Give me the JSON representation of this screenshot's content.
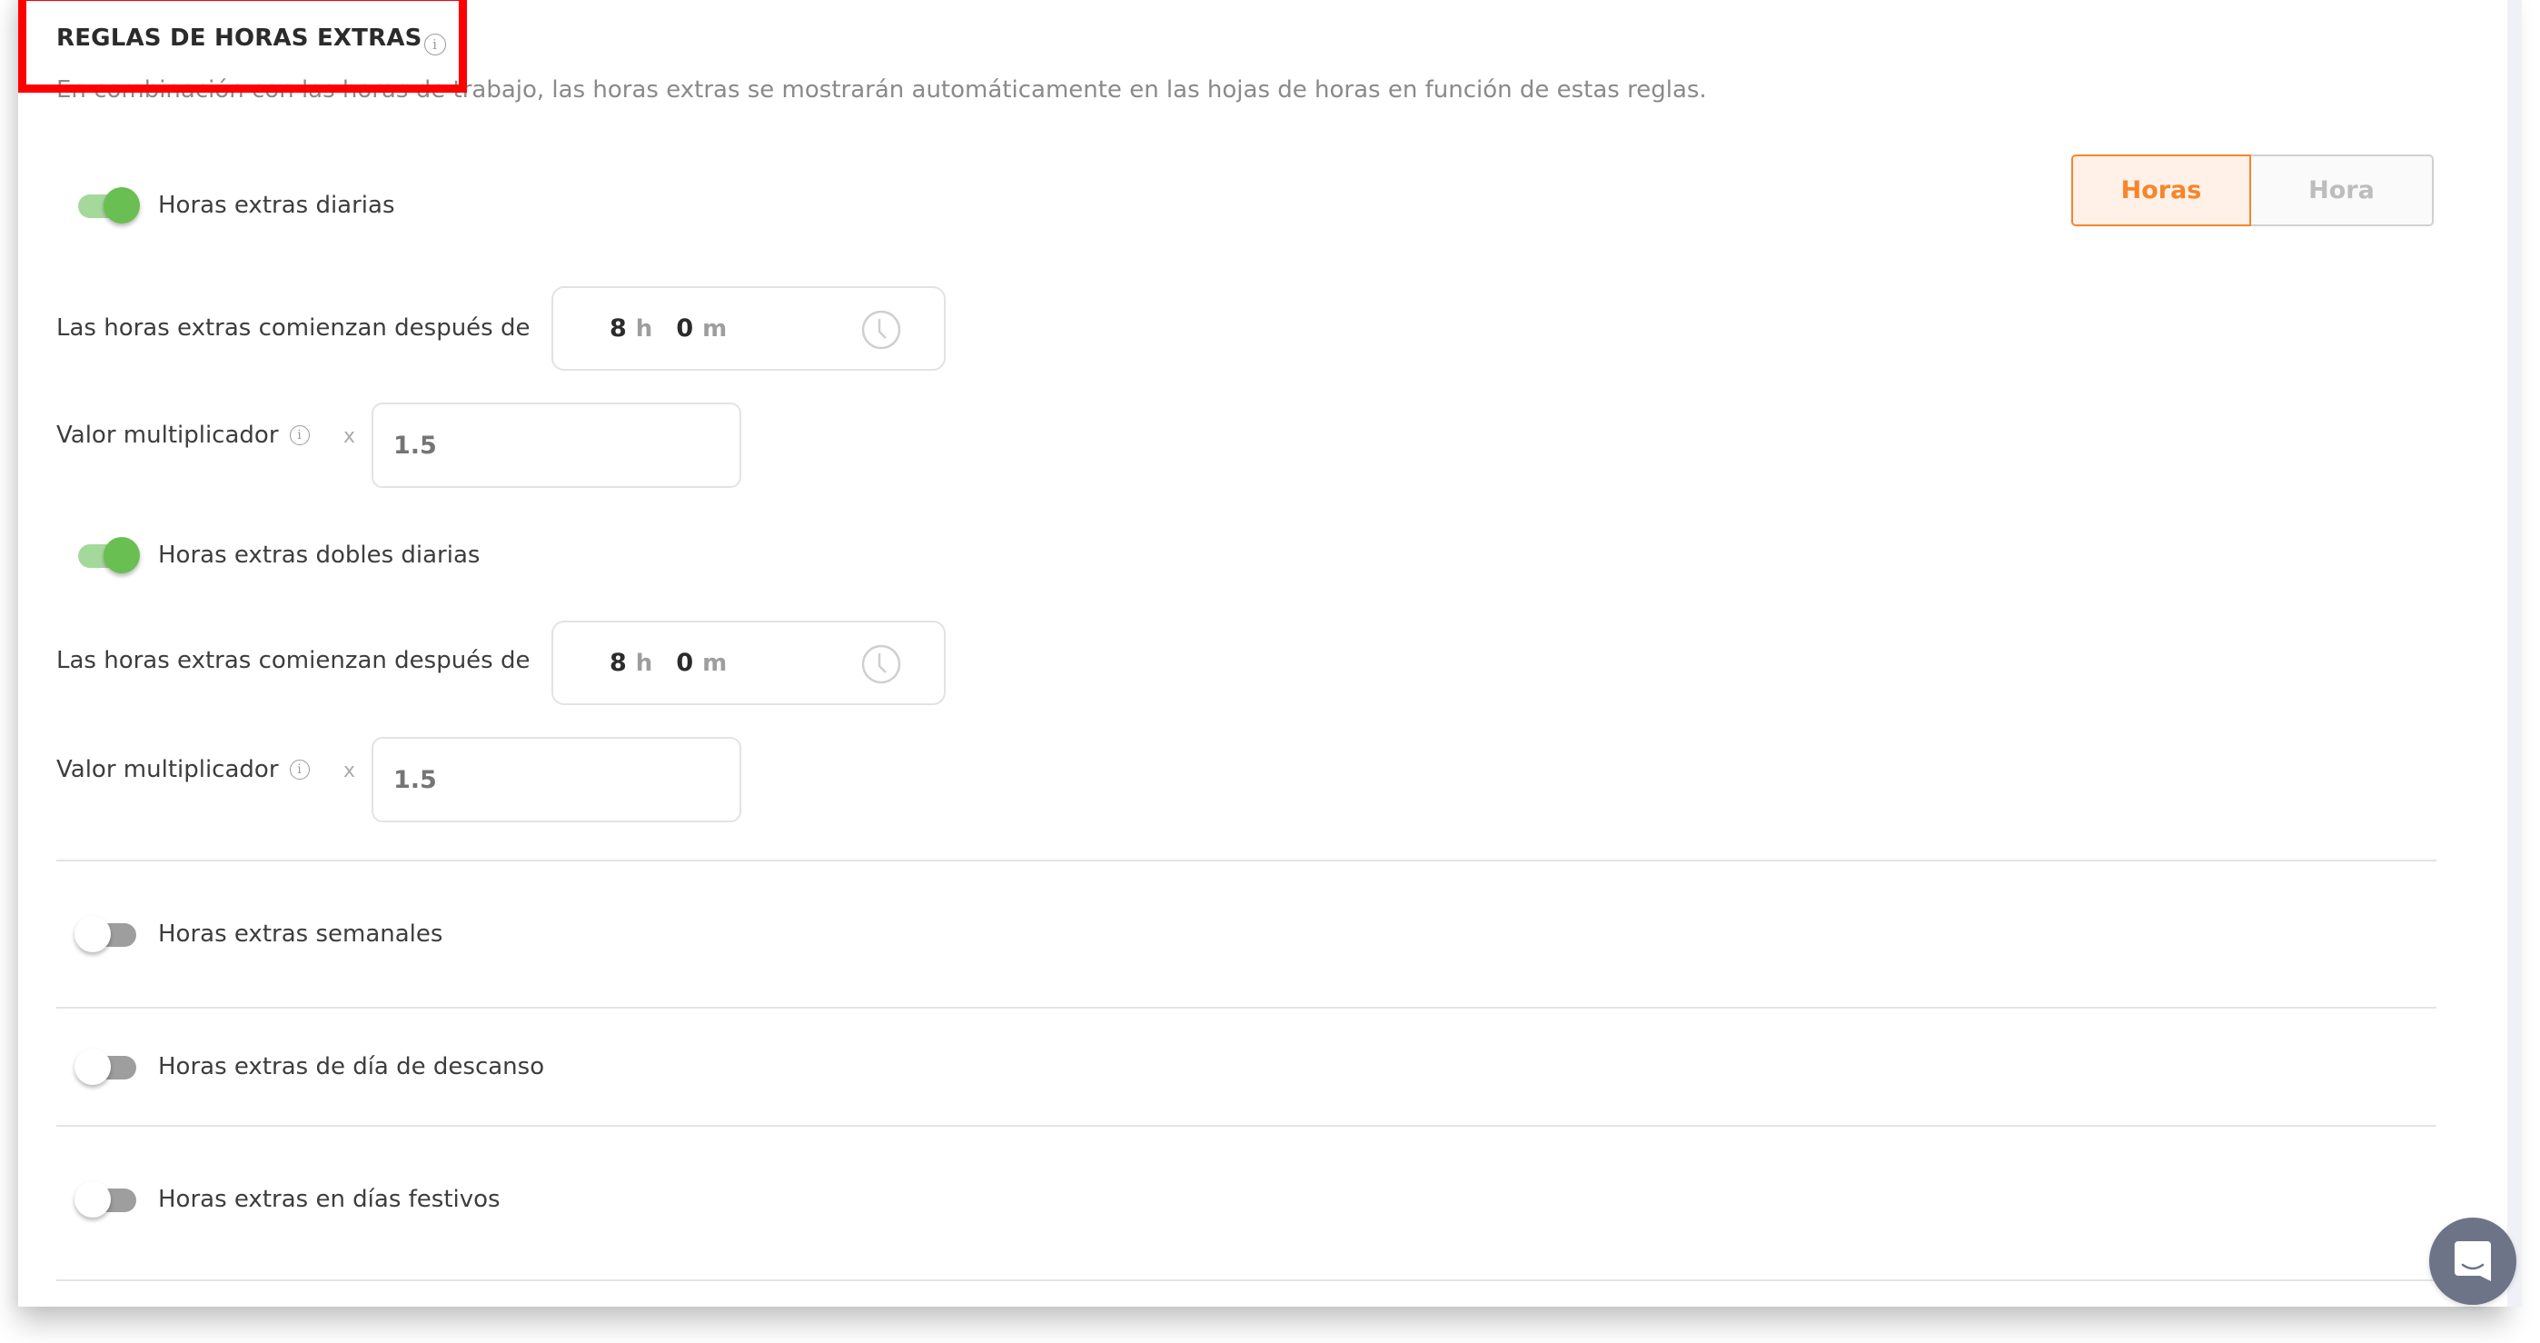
{
  "section": {
    "title": "REGLAS DE HORAS EXTRAS",
    "title_info_icon": "info-icon",
    "description": "En combinación con las horas de trabajo, las horas extras se mostrarán automáticamente en las hojas de horas en función de estas reglas."
  },
  "unit_toggle": {
    "options": [
      "Horas",
      "Hora"
    ],
    "selected": "Horas",
    "accent_color": "#f7852a"
  },
  "daily_overtime": {
    "label": "Horas extras diarias",
    "enabled": true,
    "start_after_label": "Las horas extras comienzan después de",
    "hours": "8",
    "hours_unit": "h",
    "minutes": "0",
    "minutes_unit": "m",
    "multiplier_label": "Valor multiplicador",
    "multiplier_prefix": "x",
    "multiplier_placeholder": "1.5"
  },
  "daily_double_overtime": {
    "label": "Horas extras dobles diarias",
    "enabled": true,
    "start_after_label": "Las horas extras comienzan después de",
    "hours": "8",
    "hours_unit": "h",
    "minutes": "0",
    "minutes_unit": "m",
    "multiplier_label": "Valor multiplicador",
    "multiplier_prefix": "x",
    "multiplier_placeholder": "1.5"
  },
  "other_rules": [
    {
      "label": "Horas extras semanales",
      "enabled": false
    },
    {
      "label": "Horas extras de día de descanso",
      "enabled": false
    },
    {
      "label": "Horas extras en días festivos",
      "enabled": false
    }
  ],
  "colors": {
    "toggle_on": "#6abf53",
    "toggle_off": "#9e9e9e",
    "highlight": "#ff0000",
    "chat_button": "#6d7487"
  },
  "chat": {
    "icon": "chat-bubble-icon"
  }
}
